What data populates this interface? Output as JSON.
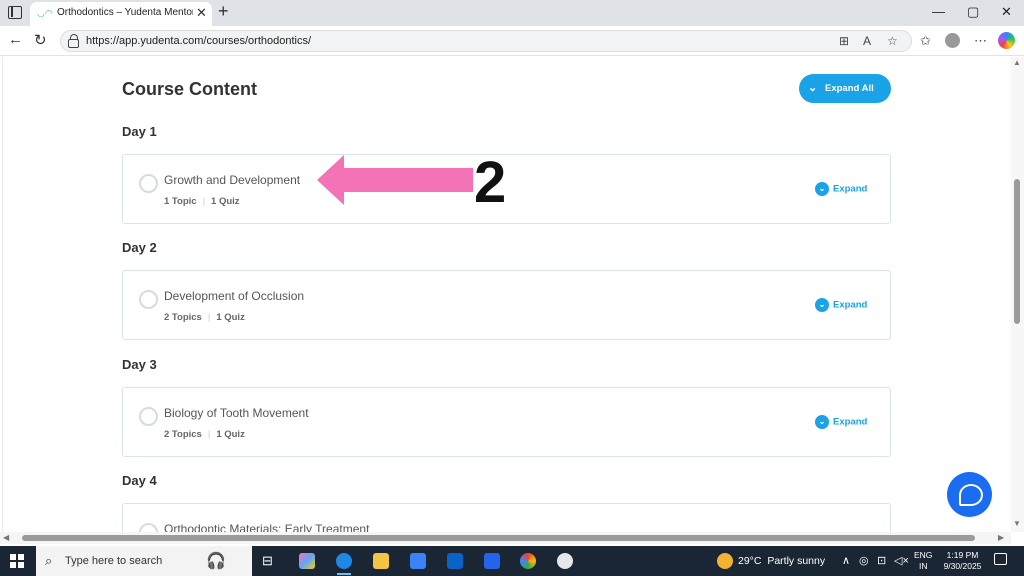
{
  "browser": {
    "tab_title": "Orthodontics – Yudenta Mentoring",
    "tab_favicon": "yudenta-favicon",
    "new_tab": "+",
    "url": "https://app.yudenta.com/courses/orthodontics/",
    "window_controls": {
      "minimize": "—",
      "maximize": "▢",
      "close": "✕"
    }
  },
  "page": {
    "title": "Course Content",
    "expand_all_label": "Expand All",
    "days": [
      {
        "heading": "Day 1",
        "lesson": "Growth and Development",
        "topics": "1 Topic",
        "quiz": "1 Quiz",
        "expand_label": "Expand"
      },
      {
        "heading": "Day 2",
        "lesson": "Development of Occlusion",
        "topics": "2 Topics",
        "quiz": "1 Quiz",
        "expand_label": "Expand"
      },
      {
        "heading": "Day 3",
        "lesson": "Biology of Tooth Movement",
        "topics": "2 Topics",
        "quiz": "1 Quiz",
        "expand_label": "Expand"
      },
      {
        "heading": "Day 4",
        "lesson": "Orthodontic Materials; Early Treatment",
        "topics": "",
        "quiz": "",
        "expand_label": ""
      }
    ],
    "annotation_number": "2",
    "accent_color": "#1aa3e6",
    "annotation_color": "#f472b6"
  },
  "taskbar": {
    "search_placeholder": "Type here to search",
    "weather_temp": "29°C",
    "weather_text": "Partly sunny",
    "lang_line1": "ENG",
    "lang_line2": "IN",
    "time": "1:19 PM",
    "date": "9/30/2025"
  }
}
